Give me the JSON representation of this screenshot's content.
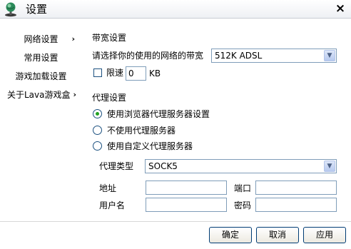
{
  "window": {
    "title": "设置",
    "close_glyph": "×",
    "icon": "globe-icon"
  },
  "sidebar": {
    "items": [
      {
        "label": "网络设置",
        "chevron": "›"
      },
      {
        "label": "常用设置",
        "chevron": ""
      },
      {
        "label": "游戏加载设置",
        "chevron": ""
      },
      {
        "label": "关于Lava游戏盒",
        "chevron": "›"
      }
    ]
  },
  "bandwidth": {
    "section_title": "带宽设置",
    "select_label": "请选择你的使用的网络的带宽",
    "select_value": "512K ADSL",
    "limit_label": "限速",
    "limit_checked": false,
    "limit_value": "0",
    "limit_unit": "KB"
  },
  "proxy": {
    "section_title": "代理设置",
    "options": [
      {
        "label": "使用浏览器代理服务器设置",
        "selected": true
      },
      {
        "label": "不使用代理服务器",
        "selected": false
      },
      {
        "label": "使用自定义代理服务器",
        "selected": false
      }
    ],
    "type_label": "代理类型",
    "type_value": "SOCK5",
    "address_label": "地址",
    "address_value": "",
    "port_label": "端口",
    "port_value": "",
    "username_label": "用户名",
    "username_value": "",
    "password_label": "密码",
    "password_value": ""
  },
  "buttons": {
    "ok": "确定",
    "cancel": "取消",
    "apply": "应用"
  },
  "colors": {
    "radio_selected": "#21a121",
    "input_border": "#7f9db9",
    "button_border": "#003c74"
  }
}
